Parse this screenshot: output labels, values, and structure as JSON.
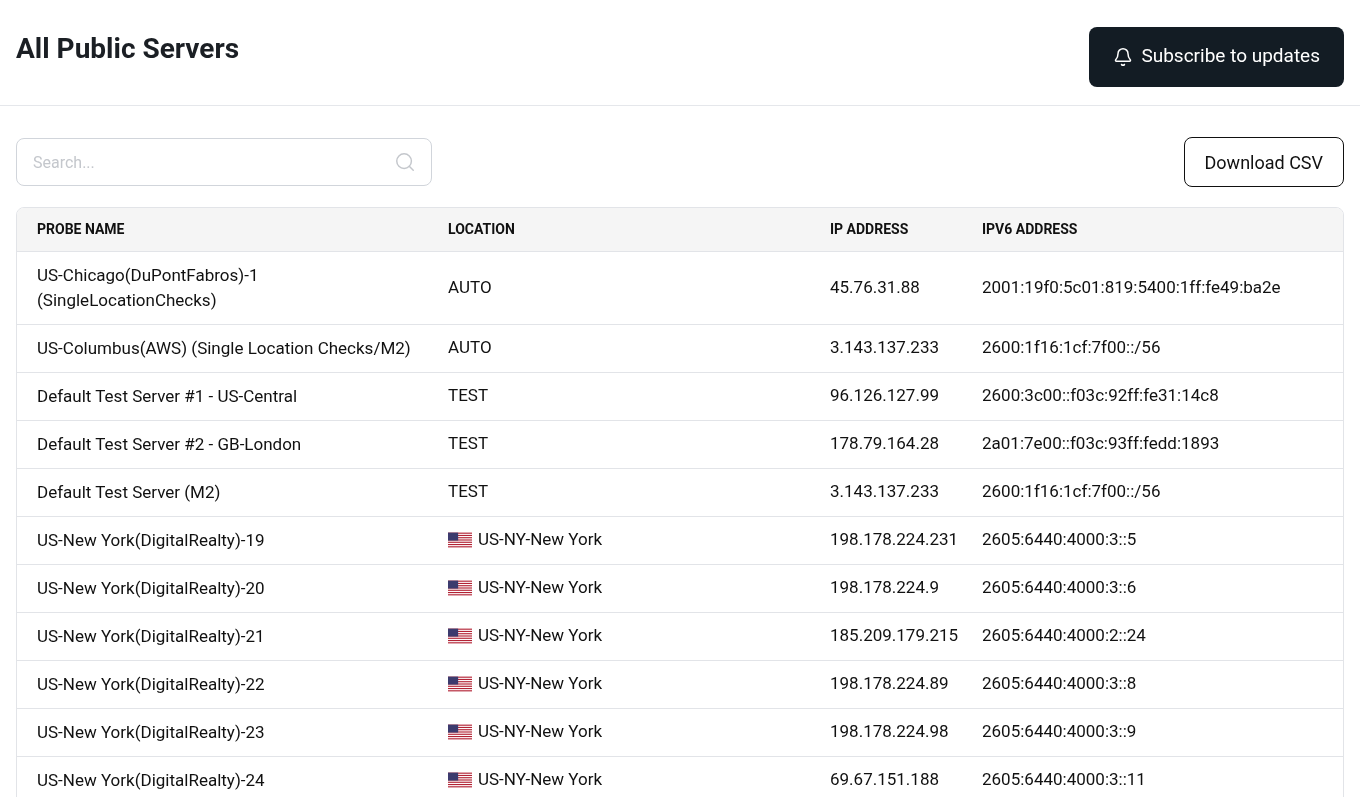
{
  "header": {
    "title": "All Public Servers",
    "subscribe_button": "Subscribe to updates"
  },
  "search": {
    "placeholder": "Search..."
  },
  "download_button": "Download CSV",
  "table": {
    "columns": [
      "PROBE NAME",
      "LOCATION",
      "IP ADDRESS",
      "IPV6 ADDRESS"
    ],
    "rows": [
      {
        "name": "US-Chicago(DuPontFabros)-1 (SingleLocationChecks)",
        "location": "AUTO",
        "flag": false,
        "ip": "45.76.31.88",
        "ipv6": "2001:19f0:5c01:819:5400:1ff:fe49:ba2e"
      },
      {
        "name": "US-Columbus(AWS) (Single Location Checks/M2)",
        "location": "AUTO",
        "flag": false,
        "ip": "3.143.137.233",
        "ipv6": "2600:1f16:1cf:7f00::/56"
      },
      {
        "name": "Default Test Server #1 - US-Central",
        "location": "TEST",
        "flag": false,
        "ip": "96.126.127.99",
        "ipv6": "2600:3c00::f03c:92ff:fe31:14c8"
      },
      {
        "name": "Default Test Server #2 - GB-London",
        "location": "TEST",
        "flag": false,
        "ip": "178.79.164.28",
        "ipv6": "2a01:7e00::f03c:93ff:fedd:1893"
      },
      {
        "name": "Default Test Server (M2)",
        "location": "TEST",
        "flag": false,
        "ip": "3.143.137.233",
        "ipv6": "2600:1f16:1cf:7f00::/56"
      },
      {
        "name": "US-New York(DigitalRealty)-19",
        "location": "US-NY-New York",
        "flag": true,
        "ip": "198.178.224.231",
        "ipv6": "2605:6440:4000:3::5"
      },
      {
        "name": "US-New York(DigitalRealty)-20",
        "location": "US-NY-New York",
        "flag": true,
        "ip": "198.178.224.9",
        "ipv6": "2605:6440:4000:3::6"
      },
      {
        "name": "US-New York(DigitalRealty)-21",
        "location": "US-NY-New York",
        "flag": true,
        "ip": "185.209.179.215",
        "ipv6": "2605:6440:4000:2::24"
      },
      {
        "name": "US-New York(DigitalRealty)-22",
        "location": "US-NY-New York",
        "flag": true,
        "ip": "198.178.224.89",
        "ipv6": "2605:6440:4000:3::8"
      },
      {
        "name": "US-New York(DigitalRealty)-23",
        "location": "US-NY-New York",
        "flag": true,
        "ip": "198.178.224.98",
        "ipv6": "2605:6440:4000:3::9"
      },
      {
        "name": "US-New York(DigitalRealty)-24",
        "location": "US-NY-New York",
        "flag": true,
        "ip": "69.67.151.188",
        "ipv6": "2605:6440:4000:3::11"
      }
    ]
  }
}
